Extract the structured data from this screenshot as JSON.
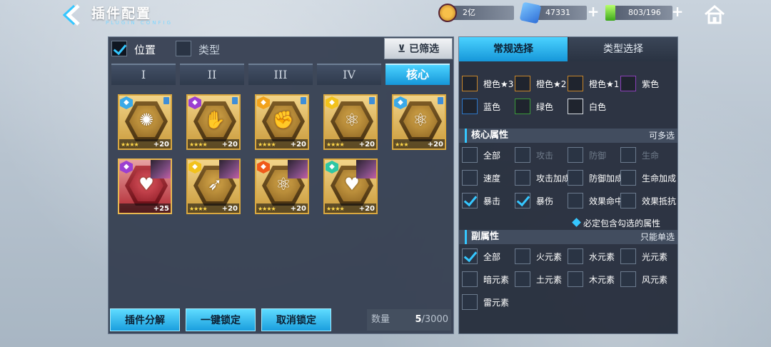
{
  "header": {
    "title": "插件配置",
    "subtitle": "PLUGIN CONFIG",
    "resources": [
      {
        "name": "gold",
        "value": "2亿"
      },
      {
        "name": "crystal",
        "value": "47331"
      },
      {
        "name": "energy",
        "value": "803/196"
      }
    ]
  },
  "filters": {
    "position_label": "位置",
    "type_label": "类型",
    "filtered_label": "已筛选"
  },
  "tabs": [
    "I",
    "II",
    "III",
    "IV",
    "核心"
  ],
  "cards": [
    {
      "glyph": "✺",
      "level": "+20",
      "stars": "★★★★",
      "element_color": "#3aa9e8",
      "red": false,
      "portrait": false
    },
    {
      "glyph": "✋",
      "level": "+20",
      "stars": "★★★★",
      "element_color": "#9b3fd1",
      "red": false,
      "portrait": false
    },
    {
      "glyph": "✊",
      "level": "+20",
      "stars": "★★★★",
      "element_color": "#f2a21b",
      "red": false,
      "portrait": false
    },
    {
      "glyph": "⚛",
      "level": "+20",
      "stars": "★★★★",
      "element_color": "#f2c21b",
      "red": false,
      "portrait": false
    },
    {
      "glyph": "⚛",
      "level": "+20",
      "stars": "★★★",
      "element_color": "#3aa9e8",
      "red": false,
      "portrait": false
    },
    {
      "glyph": "♥",
      "level": "+25",
      "stars": "",
      "element_color": "#9b3fd1",
      "red": true,
      "portrait": true
    },
    {
      "glyph": "➶",
      "level": "+20",
      "stars": "★★★★",
      "element_color": "#f2c21b",
      "red": false,
      "portrait": true
    },
    {
      "glyph": "⚛",
      "level": "+20",
      "stars": "★★★★",
      "element_color": "#f05a1a",
      "red": false,
      "portrait": true
    },
    {
      "glyph": "♥",
      "level": "+20",
      "stars": "★★★★",
      "element_color": "#2fc7a4",
      "red": false,
      "portrait": true
    }
  ],
  "actions": {
    "decompose": "插件分解",
    "lock_all": "一键锁定",
    "unlock": "取消锁定"
  },
  "count": {
    "label": "数量",
    "current": "5",
    "total": "/3000"
  },
  "right": {
    "tab_regular": "常规选择",
    "tab_type": "类型选择",
    "colors": [
      {
        "label": "橙色★3",
        "color": "#c8862a"
      },
      {
        "label": "橙色★2",
        "color": "#c8862a"
      },
      {
        "label": "橙色★1",
        "color": "#c8862a"
      },
      {
        "label": "紫色",
        "color": "#8a3fb8"
      },
      {
        "label": "蓝色",
        "color": "#2d77c8"
      },
      {
        "label": "绿色",
        "color": "#3b9a3a"
      },
      {
        "label": "白色",
        "color": "#d9dde3"
      }
    ],
    "core_section": "核心属性",
    "core_hint": "可多选",
    "core_options": [
      {
        "label": "全部",
        "checked": false,
        "disabled": false
      },
      {
        "label": "攻击",
        "checked": false,
        "disabled": true
      },
      {
        "label": "防御",
        "checked": false,
        "disabled": true
      },
      {
        "label": "生命",
        "checked": false,
        "disabled": true
      },
      {
        "label": "速度",
        "checked": false,
        "disabled": false
      },
      {
        "label": "攻击加成",
        "checked": false,
        "disabled": false
      },
      {
        "label": "防御加成",
        "checked": false,
        "disabled": false
      },
      {
        "label": "生命加成",
        "checked": false,
        "disabled": false
      },
      {
        "label": "暴击",
        "checked": true,
        "disabled": false
      },
      {
        "label": "暴伤",
        "checked": true,
        "disabled": false
      },
      {
        "label": "效果命中",
        "checked": false,
        "disabled": false
      },
      {
        "label": "效果抵抗",
        "checked": false,
        "disabled": false
      }
    ],
    "require_label": "必定包含勾选的属性",
    "sub_section": "副属性",
    "sub_hint": "只能单选",
    "sub_options": [
      {
        "label": "全部",
        "checked": true
      },
      {
        "label": "火元素",
        "checked": false
      },
      {
        "label": "水元素",
        "checked": false
      },
      {
        "label": "光元素",
        "checked": false
      },
      {
        "label": "暗元素",
        "checked": false
      },
      {
        "label": "土元素",
        "checked": false
      },
      {
        "label": "木元素",
        "checked": false
      },
      {
        "label": "风元素",
        "checked": false
      },
      {
        "label": "雷元素",
        "checked": false
      }
    ]
  }
}
